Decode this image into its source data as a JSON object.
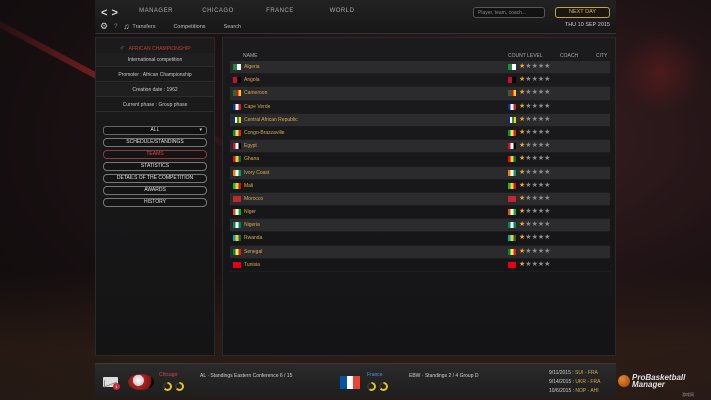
{
  "nav": {
    "back": "<",
    "forward": ">",
    "main_tabs": [
      "MANAGER",
      "CHICAGO",
      "FRANCE",
      "WORLD"
    ],
    "search_placeholder": "Player, team, coach...",
    "next_day": "NEXT DAY",
    "sub_links": [
      "Transfers",
      "Competitions",
      "Search"
    ],
    "date": "THU 10 SEP 2015"
  },
  "left_panel": {
    "competition_title": "AFRICAN CHAMPIONSHIP",
    "info": [
      "International competition",
      "Promoter : African Championship",
      "Creation date : 1962",
      "Current phase : Group phase"
    ],
    "filter_value": "ALL",
    "menu": [
      {
        "label": "SCHEDULE/STANDINGS",
        "active": false
      },
      {
        "label": "TEAMS",
        "active": true
      },
      {
        "label": "STATISTICS",
        "active": false
      },
      {
        "label": "DETAILS OF THE COMPETITION",
        "active": false
      },
      {
        "label": "AWARDS",
        "active": false
      },
      {
        "label": "HISTORY",
        "active": false
      }
    ]
  },
  "table": {
    "headers": {
      "name": "NAME",
      "level": "COUNT LEVEL",
      "coach": "COACH",
      "city": "CITY"
    },
    "rows": [
      {
        "country": "Algeria",
        "flag": [
          "#1f8a3b",
          "#ffffff"
        ],
        "stars": 1
      },
      {
        "country": "Angola",
        "flag": [
          "#c8102e",
          "#000000"
        ],
        "stars": 1
      },
      {
        "country": "Cameroon",
        "flag": [
          "#007a3d",
          "#ce1126",
          "#fcd116"
        ],
        "stars": 1
      },
      {
        "country": "Cape Verde",
        "flag": [
          "#003893",
          "#ffffff",
          "#cf2027"
        ],
        "stars": 1
      },
      {
        "country": "Central African Republic",
        "flag": [
          "#003082",
          "#ffffff",
          "#289728",
          "#ffce00"
        ],
        "stars": 1
      },
      {
        "country": "Congo-Brazzaville",
        "flag": [
          "#009543",
          "#fbde4a",
          "#dc241f"
        ],
        "stars": 1
      },
      {
        "country": "Egypt",
        "flag": [
          "#ce1126",
          "#ffffff",
          "#000000"
        ],
        "stars": 1
      },
      {
        "country": "Ghana",
        "flag": [
          "#ce1126",
          "#fcd116",
          "#006b3f"
        ],
        "stars": 1
      },
      {
        "country": "Ivory Coast",
        "flag": [
          "#f77f00",
          "#ffffff",
          "#009e60"
        ],
        "stars": 1
      },
      {
        "country": "Mali",
        "flag": [
          "#14b53a",
          "#fcd116",
          "#ce1126"
        ],
        "stars": 1
      },
      {
        "country": "Morocco",
        "flag": [
          "#c1272d",
          "#c1272d"
        ],
        "stars": 1
      },
      {
        "country": "Niger",
        "flag": [
          "#e05206",
          "#ffffff",
          "#0db02b"
        ],
        "stars": 1
      },
      {
        "country": "Nigeria",
        "flag": [
          "#008751",
          "#ffffff",
          "#008751"
        ],
        "stars": 1
      },
      {
        "country": "Rwanda",
        "flag": [
          "#00a1de",
          "#fad201",
          "#20603d"
        ],
        "stars": 1
      },
      {
        "country": "Senegal",
        "flag": [
          "#00853f",
          "#fdef42",
          "#e31b23"
        ],
        "stars": 1
      },
      {
        "country": "Tunisia",
        "flag": [
          "#e70013",
          "#e70013"
        ],
        "stars": 1
      }
    ]
  },
  "bottom": {
    "mail_count": "1",
    "team1": "Chicago",
    "team1_gauge": 0.65,
    "team1_standing": "AL · Standings Eastern Conference 6 / 15",
    "team2": "France",
    "team2_gauge": 0.6,
    "team2_standing": "EBW · Standings 2 / 4 Group D",
    "results": [
      {
        "date": "9/11/2015 :",
        "match": "SUI - FRA"
      },
      {
        "date": "9/14/2015 :",
        "match": "UKR - FRA"
      },
      {
        "date": "10/6/2015 :",
        "match": "NOP - AHI"
      }
    ],
    "brand": [
      "ProBasketball",
      "Manager"
    ],
    "brand_sub": "游戏网"
  }
}
